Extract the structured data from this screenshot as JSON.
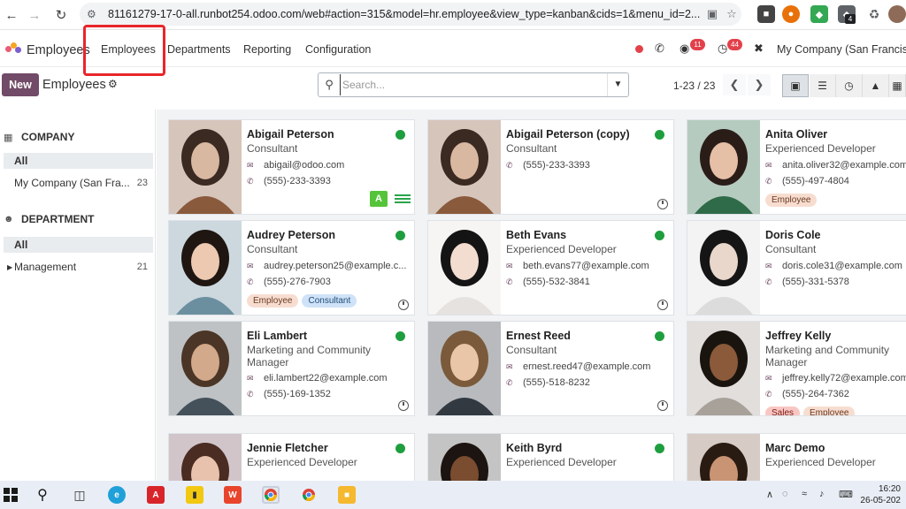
{
  "browser": {
    "url": "81161279-17-0-all.runbot254.odoo.com/web#action=315&model=hr.employee&view_type=kanban&cids=1&menu_id=2...",
    "ext_badge": "4"
  },
  "navbar": {
    "app_name": "Employees",
    "menu": [
      "Employees",
      "Departments",
      "Reporting",
      "Configuration"
    ],
    "messages_count": "11",
    "activities_count": "44",
    "company": "My Company (San Francisco)"
  },
  "control": {
    "new_label": "New",
    "breadcrumb": "Employees",
    "search_placeholder": "Search...",
    "pager": "1-23 / 23"
  },
  "sidebar": {
    "company_title": "COMPANY",
    "company_all": "All",
    "company_item": "My Company (San Fra...",
    "company_count": "23",
    "department_title": "DEPARTMENT",
    "department_all": "All",
    "department_item": "Management",
    "department_count": "21"
  },
  "employees": [
    {
      "name": "Abigail Peterson",
      "job": "Consultant",
      "email": "abigail@odoo.com",
      "phone": "(555)-233-3393",
      "tags": [],
      "avatar_letter": "A"
    },
    {
      "name": "Abigail Peterson (copy)",
      "job": "Consultant",
      "email": "",
      "phone": "(555)-233-3393",
      "tags": []
    },
    {
      "name": "Anita Oliver",
      "job": "Experienced Developer",
      "email": "anita.oliver32@example.com",
      "phone": "(555)-497-4804",
      "tags": [
        "Employee"
      ]
    },
    {
      "name": "Audrey Peterson",
      "job": "Consultant",
      "email": "audrey.peterson25@example.c...",
      "phone": "(555)-276-7903",
      "tags": [
        "Employee",
        "Consultant"
      ]
    },
    {
      "name": "Beth Evans",
      "job": "Experienced Developer",
      "email": "beth.evans77@example.com",
      "phone": "(555)-532-3841",
      "tags": []
    },
    {
      "name": "Doris Cole",
      "job": "Consultant",
      "email": "doris.cole31@example.com",
      "phone": "(555)-331-5378",
      "tags": []
    },
    {
      "name": "Eli Lambert",
      "job": "Marketing and Community Manager",
      "email": "eli.lambert22@example.com",
      "phone": "(555)-169-1352",
      "tags": []
    },
    {
      "name": "Ernest Reed",
      "job": "Consultant",
      "email": "ernest.reed47@example.com",
      "phone": "(555)-518-8232",
      "tags": []
    },
    {
      "name": "Jeffrey Kelly",
      "job": "Marketing and Community Manager",
      "email": "jeffrey.kelly72@example.com",
      "phone": "(555)-264-7362",
      "tags": [
        "Sales",
        "Employee"
      ]
    },
    {
      "name": "Jennie Fletcher",
      "job": "Experienced Developer",
      "email": "",
      "phone": "",
      "tags": []
    },
    {
      "name": "Keith Byrd",
      "job": "Experienced Developer",
      "email": "",
      "phone": "",
      "tags": []
    },
    {
      "name": "Marc Demo",
      "job": "Experienced Developer",
      "email": "",
      "phone": "",
      "tags": []
    }
  ],
  "taskbar": {
    "time": "16:20",
    "date": "26-05-202"
  }
}
